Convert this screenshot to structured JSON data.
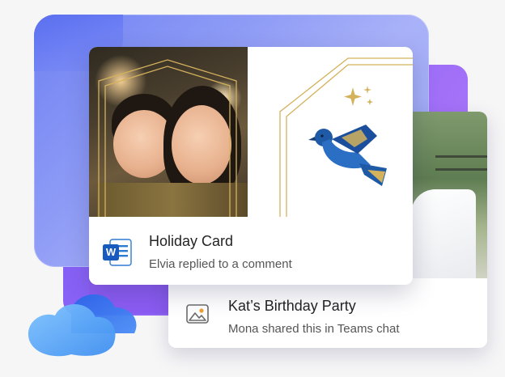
{
  "cards": [
    {
      "id": "holiday-card",
      "title": "Holiday Card",
      "subtitle": "Elvia replied to a comment",
      "app_icon": "word-icon",
      "app_icon_letter": "W"
    },
    {
      "id": "birthday-party",
      "title": "Kat’s Birthday Party",
      "subtitle": "Mona shared this in Teams chat",
      "app_icon": "image-icon"
    }
  ],
  "decor": {
    "cloud_icon": "onedrive-cloud-icon",
    "bird_icon": "bird-icon",
    "sparkle_icon": "sparkle-icon"
  },
  "colors": {
    "accent_blue": "#7c8df5",
    "accent_purple": "#8f62f6",
    "gold": "#d4b25c",
    "word_blue": "#185abd"
  }
}
